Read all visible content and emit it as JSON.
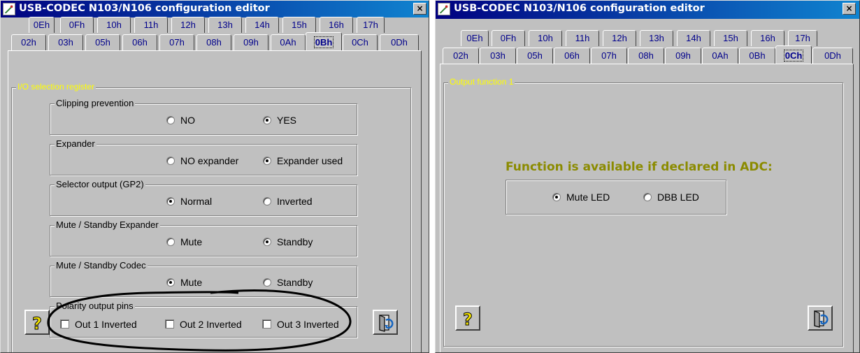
{
  "colors": {
    "title_gradient_start": "#000080",
    "title_gradient_end": "#1084d0",
    "face": "#c0c0c0",
    "tab_text": "#00008b",
    "group_title_yellow": "#ffff00",
    "notice_text": "#8b8b00",
    "annotation_ellipse": "#000000"
  },
  "left_window": {
    "title": "USB-CODEC N103/N106 configuration editor",
    "close_label": "×",
    "tabs_row_back": [
      "0Eh",
      "0Fh",
      "10h",
      "11h",
      "12h",
      "13h",
      "14h",
      "15h",
      "16h",
      "17h"
    ],
    "tabs_row_front": [
      "02h",
      "03h",
      "05h",
      "06h",
      "07h",
      "08h",
      "09h",
      "0Ah",
      "0Bh",
      "0Ch",
      "0Dh"
    ],
    "active_tab": "0Bh",
    "outer_group_title": "I/O selection register",
    "groups": [
      {
        "title": "Clipping prevention",
        "opt1": "NO",
        "opt2": "YES",
        "selected": 2
      },
      {
        "title": "Expander",
        "opt1": "NO expander",
        "opt2": "Expander used",
        "selected": 2
      },
      {
        "title": "Selector output (GP2)",
        "opt1": "Normal",
        "opt2": "Inverted",
        "selected": 1
      },
      {
        "title": "Mute / Standby Expander",
        "opt1": "Mute",
        "opt2": "Standby",
        "selected": 2
      },
      {
        "title": "Mute / Standby Codec",
        "opt1": "Mute",
        "opt2": "Standby",
        "selected": 1
      }
    ],
    "polarity": {
      "title": "Polarity output pins",
      "checks": [
        "Out 1 Inverted",
        "Out 2 Inverted",
        "Out 3 Inverted"
      ]
    },
    "help_icon": "question-mark-icon",
    "apply_icon": "door-refresh-icon"
  },
  "right_window": {
    "title": "USB-CODEC N103/N106 configuration editor",
    "close_label": "×",
    "tabs_row_back": [
      "0Eh",
      "0Fh",
      "10h",
      "11h",
      "12h",
      "13h",
      "14h",
      "15h",
      "16h",
      "17h"
    ],
    "tabs_row_front": [
      "02h",
      "03h",
      "05h",
      "06h",
      "07h",
      "08h",
      "09h",
      "0Ah",
      "0Bh",
      "0Ch",
      "0Dh"
    ],
    "active_tab": "0Ch",
    "outer_group_title": "Output function 1",
    "notice": "Function is available if declared in ADC:",
    "option1": "Mute LED",
    "option2": "DBB LED",
    "selected": 1,
    "help_icon": "question-mark-icon",
    "apply_icon": "door-refresh-icon"
  }
}
